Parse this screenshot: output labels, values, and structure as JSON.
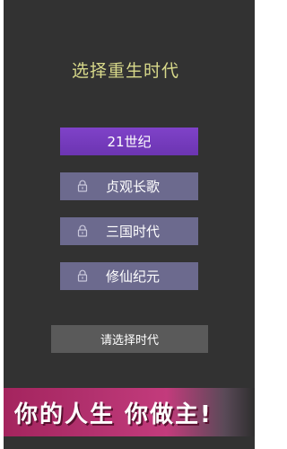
{
  "screen": {
    "title": "选择重生时代",
    "eras": [
      {
        "label": "21世纪",
        "state": "selected"
      },
      {
        "label": "贞观长歌",
        "state": "locked"
      },
      {
        "label": "三国时代",
        "state": "locked"
      },
      {
        "label": "修仙纪元",
        "state": "locked"
      }
    ],
    "confirm_label": "请选择时代",
    "banner_text": "你的人生 你做主!"
  },
  "colors": {
    "background": "#323232",
    "title": "#d8d98a",
    "selected": "#7a3ec0",
    "locked": "#6c6a8e",
    "confirm": "#5a5a5a",
    "banner": "#b2316e"
  },
  "icons": {
    "locked_era": "lock-icon"
  }
}
